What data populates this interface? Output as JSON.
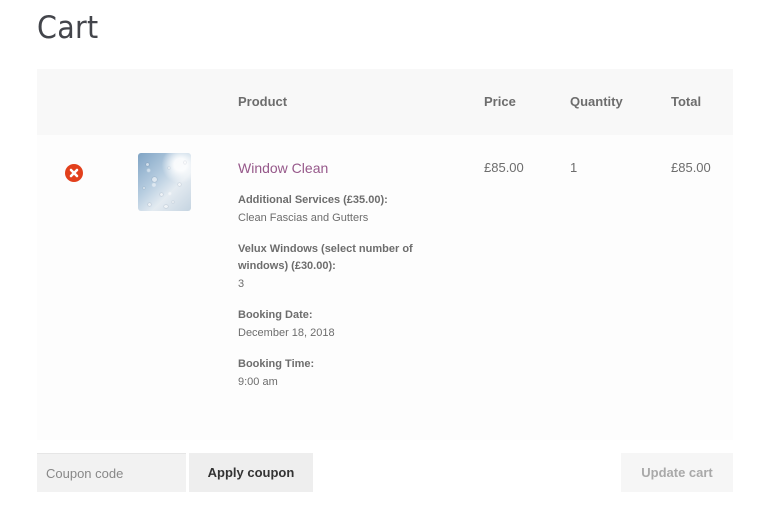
{
  "page": {
    "title": "Cart"
  },
  "table": {
    "headers": {
      "remove": "",
      "thumbnail": "",
      "product": "Product",
      "price": "Price",
      "quantity": "Quantity",
      "total": "Total"
    },
    "rows": [
      {
        "remove_icon": "remove-circle-x-icon",
        "thumbnail": "water-droplets-on-glass",
        "product_name": "Window Clean",
        "price": "£85.00",
        "quantity": "1",
        "total": "£85.00",
        "meta": [
          {
            "key": "Additional Services (£35.00):",
            "value": "Clean Fascias and Gutters"
          },
          {
            "key": "Velux Windows (select number of windows) (£30.00):",
            "value": "3"
          },
          {
            "key": "Booking Date:",
            "value": "December 18, 2018"
          },
          {
            "key": "Booking Time:",
            "value": "9:00 am"
          }
        ]
      }
    ]
  },
  "actions": {
    "coupon_placeholder": "Coupon code",
    "coupon_value": "",
    "apply_coupon_label": "Apply coupon",
    "update_cart_label": "Update cart"
  },
  "colors": {
    "accent_link": "#96588a",
    "remove_red": "#e2401c",
    "header_bg": "#f8f8f8",
    "text": "#6d6d6d"
  }
}
